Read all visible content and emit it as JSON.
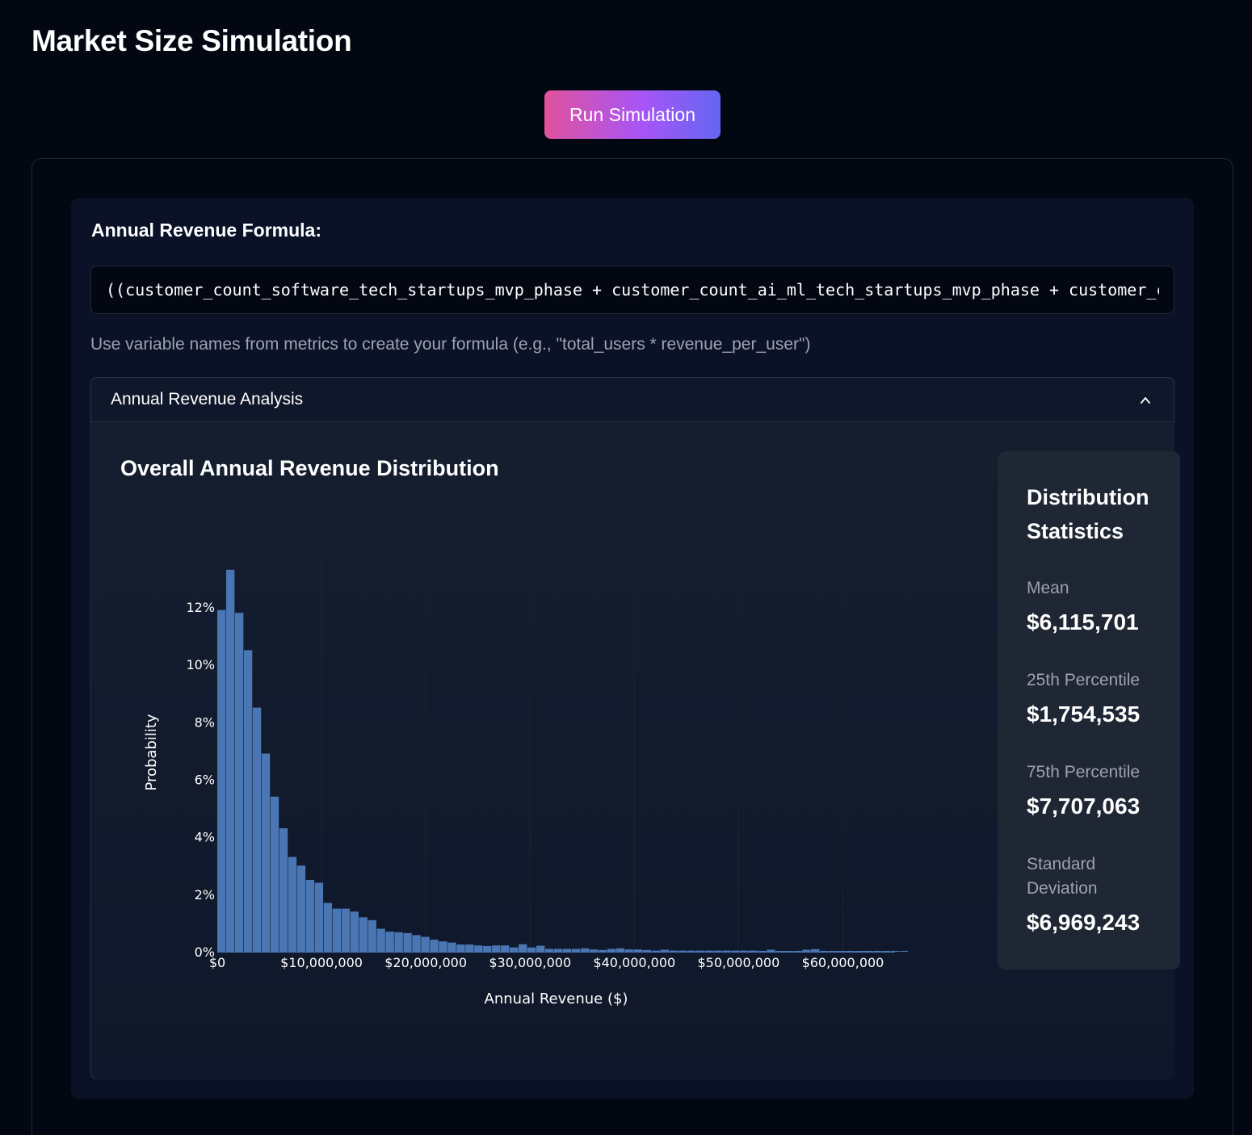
{
  "page": {
    "title": "Market Size Simulation"
  },
  "toolbar": {
    "run_label": "Run Simulation"
  },
  "formula": {
    "label": "Annual Revenue Formula:",
    "value": "((customer_count_software_tech_startups_mvp_phase + customer_count_ai_ml_tech_startups_mvp_phase + customer_count_biotech_startups_mvp_phase) * annual_revenue_per_customer)",
    "help": "Use variable names from metrics to create your formula (e.g., \"total_users * revenue_per_user\")"
  },
  "accordion": {
    "title": "Annual Revenue Analysis",
    "icon": "chevron-up-icon",
    "expanded": true
  },
  "chart": {
    "title": "Overall Annual Revenue Distribution"
  },
  "stats": {
    "title": "Distribution Statistics",
    "items": [
      {
        "label": "Mean",
        "value": "$6,115,701"
      },
      {
        "label": "25th Percentile",
        "value": "$1,754,535"
      },
      {
        "label": "75th Percentile",
        "value": "$7,707,063"
      },
      {
        "label": "Standard Deviation",
        "value": "$6,969,243"
      }
    ]
  },
  "colors": {
    "background": "#030712",
    "bar": "#4a77b4",
    "button_gradient": [
      "#e0529c",
      "#a855f7",
      "#6366f1"
    ]
  },
  "chart_data": {
    "type": "bar",
    "xlabel": "Annual Revenue ($)",
    "ylabel": "Probability",
    "xlim": [
      0,
      65000000
    ],
    "ylim": [
      0,
      0.138
    ],
    "bin_width": 850000,
    "x_ticks": [
      0,
      10000000,
      20000000,
      30000000,
      40000000,
      50000000,
      60000000
    ],
    "x_tick_labels": [
      "$0",
      "$10,000,000",
      "$20,000,000",
      "$30,000,000",
      "$40,000,000",
      "$50,000,000",
      "$60,000,000"
    ],
    "y_ticks": [
      0,
      0.02,
      0.04,
      0.06,
      0.08,
      0.1,
      0.12
    ],
    "y_tick_labels": [
      "0%",
      "2%",
      "4%",
      "6%",
      "8%",
      "10%",
      "12%"
    ],
    "values": [
      0.119,
      0.133,
      0.118,
      0.105,
      0.085,
      0.069,
      0.054,
      0.043,
      0.033,
      0.03,
      0.025,
      0.024,
      0.017,
      0.015,
      0.015,
      0.014,
      0.012,
      0.011,
      0.008,
      0.007,
      0.0068,
      0.0065,
      0.0058,
      0.0052,
      0.0042,
      0.0036,
      0.0032,
      0.0025,
      0.0025,
      0.0022,
      0.002,
      0.0022,
      0.0022,
      0.0015,
      0.0026,
      0.0015,
      0.0021,
      0.001,
      0.001,
      0.001,
      0.001,
      0.0012,
      0.0008,
      0.0006,
      0.001,
      0.0012,
      0.0008,
      0.0008,
      0.0006,
      0.0004,
      0.0007,
      0.0004,
      0.0004,
      0.0004,
      0.0004,
      0.0004,
      0.0004,
      0.0004,
      0.0004,
      0.0004,
      0.0004,
      0.0003,
      0.0007,
      0.0003,
      0.0003,
      0.0003,
      0.0007,
      0.0009,
      0.0003,
      0.0003,
      0.0003,
      0.0003,
      0.0003,
      0.0003,
      0.0003,
      0.0003,
      0.0003,
      0.0003
    ]
  }
}
